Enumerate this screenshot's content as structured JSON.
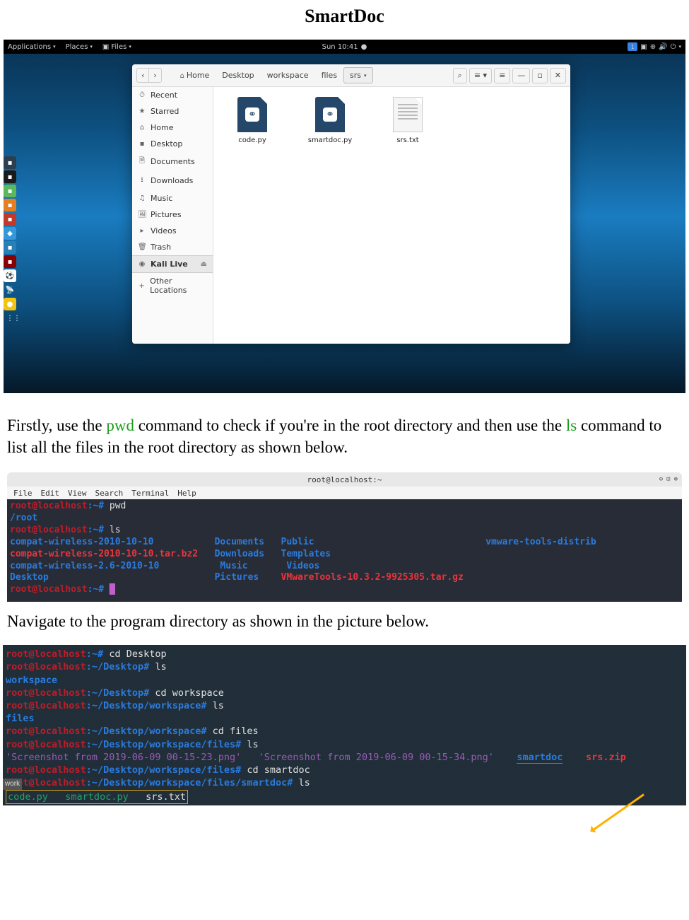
{
  "doc": {
    "title": "SmartDoc",
    "para1_a": "Firstly, use the ",
    "para1_cmd1": "pwd",
    "para1_b": " command to check if you're in the root directory and then use the ",
    "para1_cmd2": "ls",
    "para1_c": " command to list all the files in the root directory as shown below.",
    "para2": "Navigate to the program directory as shown in the picture below."
  },
  "topbar": {
    "apps": "Applications",
    "places": "Places",
    "files": "Files",
    "clock": "Sun 10:41",
    "badge": "1"
  },
  "fm": {
    "home_crumb": "Home",
    "crumbs": [
      "Desktop",
      "workspace",
      "files",
      "srs"
    ],
    "search_icon": "⌕",
    "sidebar": {
      "recent": "Recent",
      "starred": "Starred",
      "home": "Home",
      "desktop": "Desktop",
      "documents": "Documents",
      "downloads": "Downloads",
      "music": "Music",
      "pictures": "Pictures",
      "videos": "Videos",
      "trash": "Trash",
      "kali": "Kali Live",
      "other": "Other Locations"
    },
    "files": {
      "f1": "code.py",
      "f2": "smartdoc.py",
      "f3": "srs.txt"
    }
  },
  "term2": {
    "title": "root@localhost:~",
    "menu": [
      "File",
      "Edit",
      "View",
      "Search",
      "Terminal",
      "Help"
    ],
    "prompt": "root@localhost",
    "tilde": ":~#",
    "pwd_cmd": " pwd",
    "pwd_out": "/root",
    "ls_cmd": " ls",
    "ls": {
      "c1r1": "compat-wireless-2010-10-10",
      "c1r2": "compat-wireless-2010-10-10.tar.bz2",
      "c1r3": "compat-wireless-2.6-2010-10",
      "c1r4": "Desktop",
      "c2r1": "Documents",
      "c2r2": "Downloads",
      "c2r3": "Music",
      "c2r4": "Pictures",
      "c3r1": "Public",
      "c3r2": "Templates",
      "c3r3": "Videos",
      "c3r4": "VMwareTools-10.3.2-9925305.tar.gz",
      "c4r1": "vmware-tools-distrib"
    }
  },
  "term3": {
    "prompt": "root@localhost",
    "home": ":~#",
    "desktop_path": ":~/Desktop#",
    "ws_path": ":~/Desktop/workspace#",
    "files_path": ":~/Desktop/workspace/files#",
    "smart_path": ":~/Desktop/workspace/files/smartdoc#",
    "cd_desktop": " cd Desktop",
    "ls": " ls",
    "workspace": "workspace",
    "cd_ws": " cd workspace",
    "files_out": "files",
    "cd_files": " cd files",
    "files_ls": {
      "s1": "'Screenshot from 2019-06-09 00-15-23.png'",
      "s2": "'Screenshot from 2019-06-09 00-15-34.png'",
      "smartdoc": "smartdoc",
      "srszip": "srs.zip"
    },
    "cd_smart": " cd smartdoc",
    "smart_ls": {
      "code": "code.py",
      "smart": "smartdoc.py",
      "srs": "srs.txt"
    },
    "work_label": "work"
  }
}
